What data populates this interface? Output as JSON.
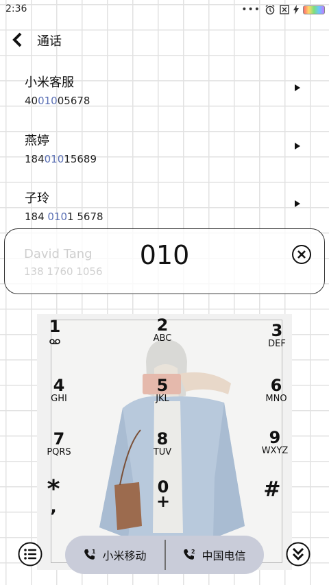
{
  "status_bar": {
    "time": "2:36",
    "dots": "•••"
  },
  "header": {
    "title": "通话"
  },
  "contacts": [
    {
      "name": "小米客服",
      "number_pre": "40",
      "number_match": "010",
      "number_post": "05678"
    },
    {
      "name": "燕婷",
      "number_pre": "184",
      "number_match": "010",
      "number_post": "15689"
    },
    {
      "name": "子玲",
      "number_pre": "184 ",
      "number_match": "010",
      "number_post": "1 5678"
    }
  ],
  "dial": {
    "input_value": "010",
    "ghost_name": "David Tang",
    "ghost_number": "138 1760 1056"
  },
  "keys": [
    {
      "digit": "1",
      "letters": ""
    },
    {
      "digit": "2",
      "letters": "ABC"
    },
    {
      "digit": "3",
      "letters": "DEF"
    },
    {
      "digit": "4",
      "letters": "GHI"
    },
    {
      "digit": "5",
      "letters": "JKL"
    },
    {
      "digit": "6",
      "letters": "MNO"
    },
    {
      "digit": "7",
      "letters": "PQRS"
    },
    {
      "digit": "8",
      "letters": "TUV"
    },
    {
      "digit": "9",
      "letters": "WXYZ"
    },
    {
      "digit": "*",
      "letters": ","
    },
    {
      "digit": "0",
      "letters": "+"
    },
    {
      "digit": "#",
      "letters": ""
    }
  ],
  "sims": [
    {
      "label": "小米移动",
      "icon": "phone-sim1-icon"
    },
    {
      "label": "中国电信",
      "icon": "phone-sim2-icon"
    }
  ],
  "colors": {
    "match_highlight": "#5a6fb4",
    "sim_pill": "#c9ccd9"
  }
}
